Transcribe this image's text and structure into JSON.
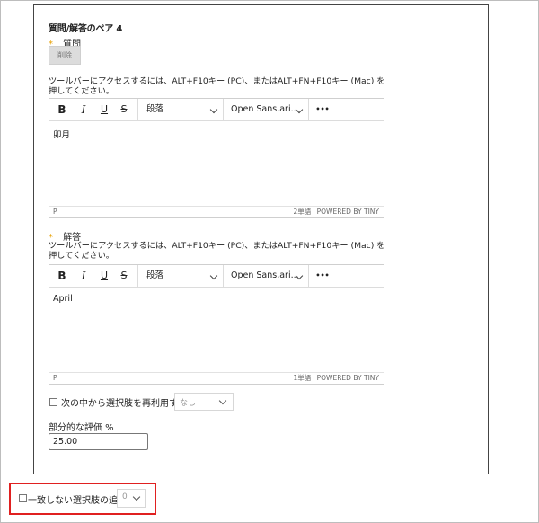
{
  "pair_section": {
    "title": "質問/解答のペア 4",
    "required_mark": "*",
    "question_label": "質問",
    "delete_button": "削除",
    "answer_label": "解答"
  },
  "editor_help": "ツールバーにアクセスするには、ALT+F10キー (PC)、またはALT+FN+F10キー (Mac) を押してください。",
  "toolbar": {
    "bold": "B",
    "italic": "I",
    "underline": "U",
    "strike": "S",
    "block_format": "段落",
    "font_family": "Open Sans,ari...",
    "more": "•••"
  },
  "question_editor": {
    "content": "卯月",
    "path": "P",
    "word_count": "2単語",
    "powered_by": "POWERED BY TINY"
  },
  "answer_editor": {
    "content": "April",
    "path": "P",
    "word_count": "1単語",
    "powered_by": "POWERED BY TINY"
  },
  "reuse_choices": {
    "label": "次の中から選択肢を再利用する",
    "selected": "なし"
  },
  "partial_grade": {
    "label": "部分的な評価 %",
    "value": "25.00"
  },
  "add_unmatched": {
    "label": "一致しない選択肢の追加",
    "selected": "0"
  },
  "colors": {
    "required_star": "#e8a000",
    "highlight": "#e02020"
  }
}
